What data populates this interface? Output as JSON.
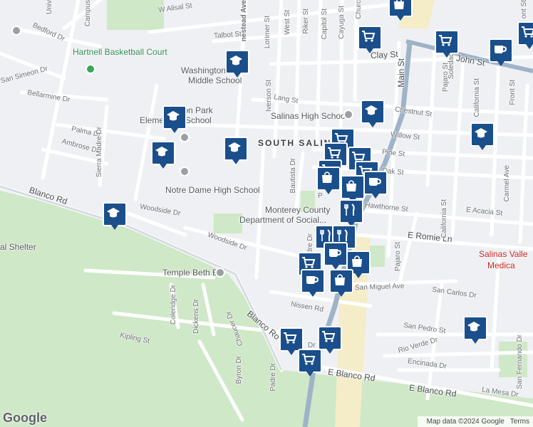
{
  "colors": {
    "background": "#eef0f3",
    "green_area": "#cfe8c7",
    "road": "#ffffff",
    "highway": "#9fb3c8",
    "commercial": "#f5ecc8",
    "poi_marker": "#1a4f8b",
    "hospital_text": "#c5221f"
  },
  "streets": {
    "w_alisal": "W Alisal St",
    "talbot": "Talbot St",
    "bedford": "Bedford Dr",
    "univ": "Univ",
    "campus": "Campus",
    "homestead": "nestead Ave",
    "lorimer": "Lorimer St",
    "west": "West St",
    "riker": "Riker St",
    "capitol": "Capitol St",
    "cayuga": "Cayuga St",
    "church": "Churc",
    "clay": "Clay St",
    "john": "John St",
    "front_top": "ont St",
    "san_simeon": "San Simeon Dr",
    "bellarmine": "Bellarmine Dr",
    "iverson": "Iverson St",
    "lang": "Lang St",
    "main": "Main St",
    "chestnut": "Chestnut St",
    "willow": "Willow St",
    "pine": "Pine St",
    "oak": "Oak St",
    "palma": "Palma Dr",
    "ambrose": "Ambrose Dr",
    "sierra_madre": "Sierra Madre Dr",
    "bautista": "Bautista Dr",
    "blanco_rd_left": "Blanco Rd",
    "woodside_top": "Woodside Dr",
    "woodside_mid": "Woodside Dr",
    "hawthorne": "Hawthorne St",
    "e_acacia": "E Acacia St",
    "e_romie": "E Romie Ln",
    "pajaro_top": "Pajaro St",
    "pajaro_mid": "Pajaro St",
    "california_top": "California St",
    "california_mid": "California St",
    "soledad": "Soledad St",
    "carmel": "Carmel Ave",
    "front_right": "Front St",
    "padre_mid": "adre Dr",
    "san_miguel": "San Miguel Ave",
    "san_carlos": "San Carlos Dr",
    "coleridge": "Coleridge Dr",
    "dickens": "Dickens Dr",
    "chaucer": "Chaucer Dr",
    "nissen": "Nissen Rd",
    "blanco_ro": "Blanco Ro",
    "kipling": "Kipling St",
    "byron": "Byron Dr",
    "padre_bottom": "Padre Dr",
    "dr_short": "Dr",
    "san_pedro": "San Pedro St",
    "rio_verde": "Rio Verde Dr",
    "encinada": "Encinada Dr",
    "e_blanco_1": "E Blanco Rd",
    "e_blanco_2": "E Blanco Rd",
    "la_mesa": "La Mesa Dr",
    "san_fernando": "San Fernando Dr",
    "fremont_piece": "P",
    "nt_st": "nt St"
  },
  "places": {
    "hartnell": "Hartnell Basketball Court",
    "washington": "Washington",
    "washington_2": "Middle School",
    "mission_park": "Mission Park",
    "mission_park_2": "Elementary School",
    "salinas_high": "Salinas High School",
    "south_salinas": "SOUTH SALIN",
    "notre_dame": "Notre Dame High School",
    "monterey": "Monterey County",
    "monterey_2": "Department of Social...",
    "animal_shelter": "al Shelter",
    "temple": "Temple Beth El",
    "hospital": "Salinas Valle",
    "hospital_2": "Medica",
    "park_left": "ark"
  },
  "poi_icons": [
    "school-icon",
    "shopping-cart-icon",
    "coffee-icon",
    "shopping-bag-icon",
    "restaurant-icon"
  ],
  "footer": {
    "map_data": "Map data ©2024 Google",
    "terms": "Terms",
    "logo": "Google"
  }
}
